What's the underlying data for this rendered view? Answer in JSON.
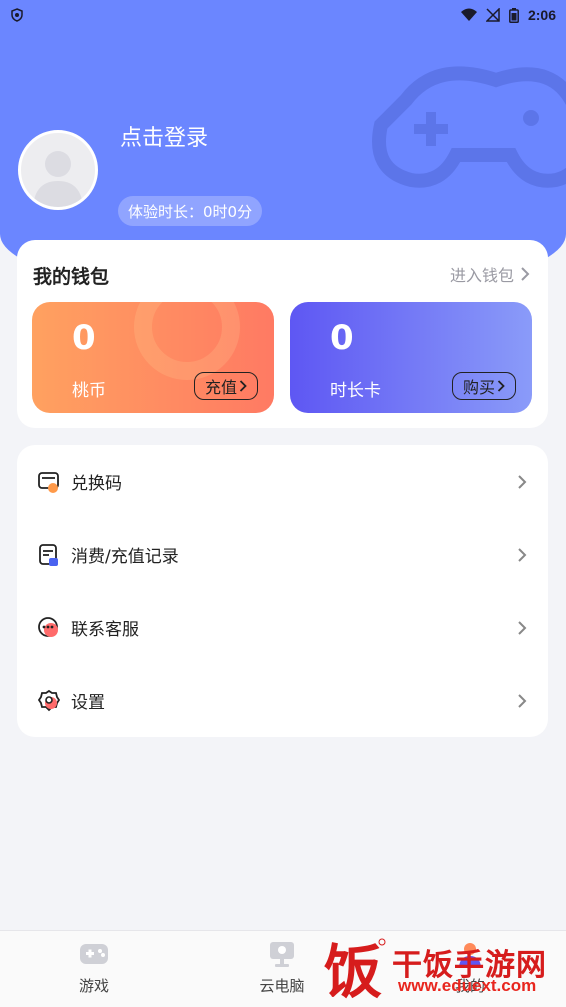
{
  "statusbar": {
    "time": "2:06"
  },
  "header": {
    "login_text": "点击登录",
    "trial_text": "体验时长：0时0分"
  },
  "wallet": {
    "title": "我的钱包",
    "link_text": "进入钱包",
    "coins": {
      "value": "0",
      "label": "桃币",
      "button": "充值"
    },
    "time_card": {
      "value": "0",
      "label": "时长卡",
      "button": "购买"
    }
  },
  "menu": {
    "items": [
      {
        "label": "兑换码",
        "icon": "redeem-code-icon"
      },
      {
        "label": "消费/充值记录",
        "icon": "records-icon"
      },
      {
        "label": "联系客服",
        "icon": "customer-service-icon"
      },
      {
        "label": "设置",
        "icon": "settings-icon"
      }
    ]
  },
  "bottom_nav": {
    "items": [
      {
        "label": "游戏",
        "icon": "gamepad-icon"
      },
      {
        "label": "云电脑",
        "icon": "cloud-pc-icon"
      },
      {
        "label": "我的",
        "icon": "profile-icon"
      }
    ]
  },
  "watermark": {
    "text": "干饭手游网",
    "url": "www.eduext.com",
    "logo": "饭"
  },
  "colors": {
    "header_blue": "#6b86ff",
    "coins_gradient_start": "#ffa160",
    "coins_gradient_end": "#ff7a63",
    "time_gradient_start": "#5e57f3",
    "time_gradient_end": "#8a9bf9",
    "watermark_red": "#d61c1c"
  }
}
